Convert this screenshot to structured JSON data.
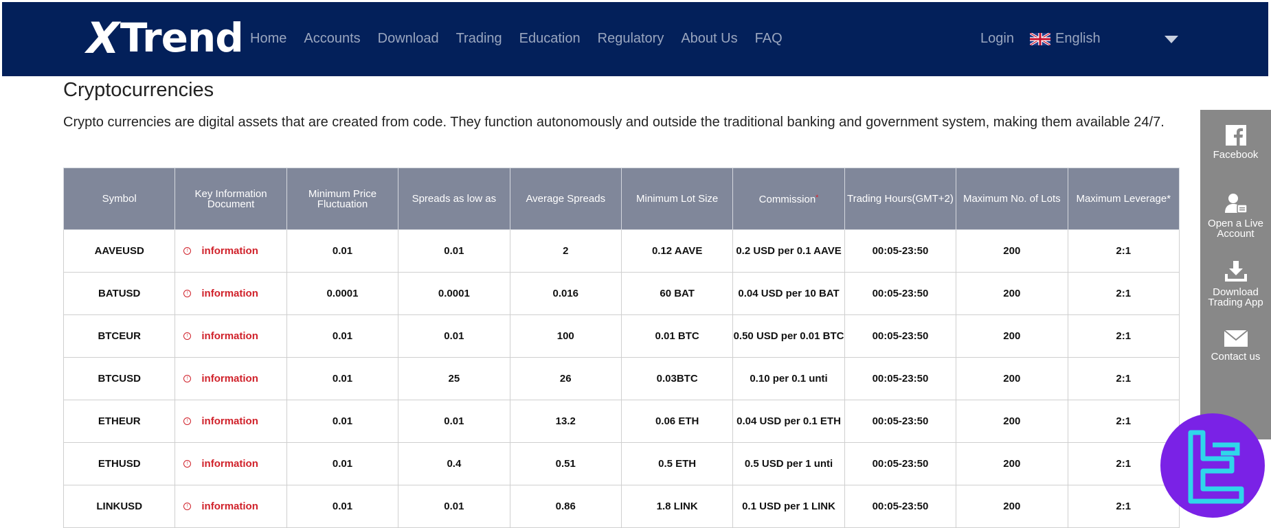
{
  "header": {
    "logo": {
      "x": "X",
      "rest": "Trend"
    },
    "nav": [
      "Home",
      "Accounts",
      "Download",
      "Trading",
      "Education",
      "Regulatory",
      "About Us",
      "FAQ"
    ],
    "login": "Login",
    "language": "English"
  },
  "page": {
    "title": "Cryptocurrencies",
    "description": "Crypto currencies are digital assets that are created from code. They function autonomously and outside the traditional banking and government system, making them available 24/7."
  },
  "table": {
    "headers": [
      "Symbol",
      "Key Information Document",
      "Minimum Price Fluctuation",
      "Spreads as low as",
      "Average Spreads",
      "Minimum Lot Size",
      "Commission",
      "Trading Hours(GMT+2)",
      "Maximum No. of Lots",
      "Maximum Leverage*"
    ],
    "commission_asterisk": "*",
    "rows": [
      [
        "AAVEUSD",
        "information",
        "0.01",
        "0.01",
        "2",
        "0.12 AAVE",
        "0.2 USD per 0.1 AAVE",
        "00:05-23:50",
        "200",
        "2:1"
      ],
      [
        "BATUSD",
        "information",
        "0.0001",
        "0.0001",
        "0.016",
        "60 BAT",
        "0.04 USD per 10 BAT",
        "00:05-23:50",
        "200",
        "2:1"
      ],
      [
        "BTCEUR",
        "information",
        "0.01",
        "0.01",
        "100",
        "0.01 BTC",
        "0.50 USD per 0.01 BTC",
        "00:05-23:50",
        "200",
        "2:1"
      ],
      [
        "BTCUSD",
        "information",
        "0.01",
        "25",
        "26",
        "0.03BTC",
        "0.10 per 0.1 unti",
        "00:05-23:50",
        "200",
        "2:1"
      ],
      [
        "ETHEUR",
        "information",
        "0.01",
        "0.01",
        "13.2",
        "0.06 ETH",
        "0.04 USD per 0.1 ETH",
        "00:05-23:50",
        "200",
        "2:1"
      ],
      [
        "ETHUSD",
        "information",
        "0.01",
        "0.4",
        "0.51",
        "0.5 ETH",
        "0.5 USD per 1 unti",
        "00:05-23:50",
        "200",
        "2:1"
      ],
      [
        "LINKUSD",
        "information",
        "0.01",
        "0.01",
        "0.86",
        "1.8 LINK",
        "0.1 USD per 1 LINK",
        "00:05-23:50",
        "200",
        "2:1"
      ]
    ]
  },
  "sidebar": {
    "facebook": "Facebook",
    "live_account": [
      "Open a Live",
      "Account"
    ],
    "download_app": [
      "Download",
      "Trading App"
    ],
    "contact": "Contact us"
  },
  "colors": {
    "header_bg": "#03205a",
    "table_header_bg": "#80879a",
    "link_red": "#d0212a",
    "sidebar_bg": "#888888",
    "badge_bg": "#7a22e6",
    "badge_icon": "#2fd6ea"
  },
  "icons": {
    "facebook": "facebook-icon",
    "account": "user-card-icon",
    "download": "download-icon",
    "contact": "envelope-icon",
    "info": "info-circle-icon",
    "caret": "caret-down-icon"
  }
}
